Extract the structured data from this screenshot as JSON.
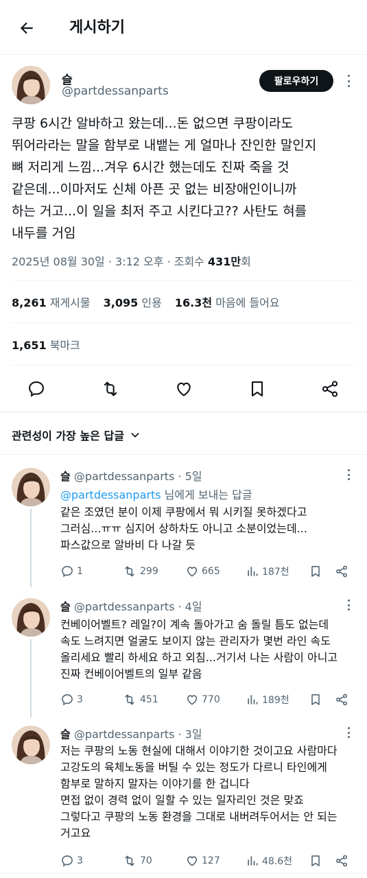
{
  "header": {
    "title": "게시하기"
  },
  "post": {
    "author_name": "슬",
    "author_handle": "@partdessanparts",
    "follow_label": "팔로우하기",
    "text_lines": [
      "쿠팡 6시간 알바하고 왔는데...돈 없으면 쿠팡이라도",
      "뛰어라라는 말을 함부로 내뱉는 게 얼마나 잔인한 말인지",
      "뼈 저리게 느낌...겨우 6시간 했는데도 진짜 죽을 것",
      "같은데...이마저도 신체 아픈 곳 없는 비장애인이니까",
      "하는 거고...이 일을 최저 주고 시킨다고?? 사탄도 혀를",
      "내두를 거임"
    ],
    "meta_date": "2025년 08월 30일 · 3:12 오후 · 조회수 ",
    "meta_views": "431만",
    "meta_views_suffix": "회",
    "stats": {
      "reposts_value": "8,261",
      "reposts_label": " 재게시물",
      "quotes_value": "3,095",
      "quotes_label": " 인용",
      "likes_value": "16.3천",
      "likes_label": " 마음에 들어요",
      "bookmarks_value": "1,651",
      "bookmarks_label": " 북마크"
    }
  },
  "sort_label": "관련성이 가장 높은 답글",
  "replies": [
    {
      "name": "슬",
      "handle": " @partdessanparts · 5일",
      "to_link": "@partdessanparts",
      "to_suffix": " 님에게 보내는 답글",
      "lines": [
        "같은 조였던 분이 이제 쿠팡에서 뭐 시키질 못하겠다고",
        "그러심...ㅠㅠ 심지어 상하차도 아니고 소분이었는데...",
        "파스값으로 알바비 다 나갈 듯"
      ],
      "comments": "1",
      "reposts": "299",
      "likes": "665",
      "views": "187천"
    },
    {
      "name": "슬",
      "handle": " @partdessanparts · 4일",
      "lines": [
        "컨베이어벨트? 레일?이 계속 돌아가고 숨 돌릴 틈도 없는데",
        "속도 느려지면 얼굴도 보이지 않는 관리자가 몇번 라인 속도",
        "올리세요 빨리 하세요 하고 외침...거기서 나는 사람이 아니고",
        "진짜 컨베이어벨트의 일부 같음"
      ],
      "comments": "3",
      "reposts": "451",
      "likes": "770",
      "views": "189천"
    },
    {
      "name": "슬",
      "handle": " @partdessanparts · 3일",
      "lines": [
        "저는 쿠팡의 노동 현실에 대해서 이야기한 것이고요 사람마다",
        "고강도의 육체노동을 버틸 수 있는 정도가 다르니 타인에게",
        "함부로 말하지 말자는 이야기를 한 겁니다",
        "면접 없이 경력 없이 일할 수 있는 일자리인 것은 맞죠",
        "그렇다고 쿠팡의 노동 환경을 그대로 내버려두어서는 안 되는",
        "거고요"
      ],
      "comments": "3",
      "reposts": "70",
      "likes": "127",
      "views": "48.6천"
    }
  ],
  "icons": {
    "back": "arrow-left-icon",
    "more": "more-vertical-icon",
    "reply": "comment-icon",
    "repost": "repost-icon",
    "like": "heart-icon",
    "bookmark": "bookmark-icon",
    "share": "share-icon",
    "views": "views-bar-chart-icon",
    "sort": "chevron-down-icon"
  },
  "colors": {
    "accent_link": "#1d9bf0",
    "follow_bg": "#0f1419",
    "secondary_text": "#536471"
  }
}
